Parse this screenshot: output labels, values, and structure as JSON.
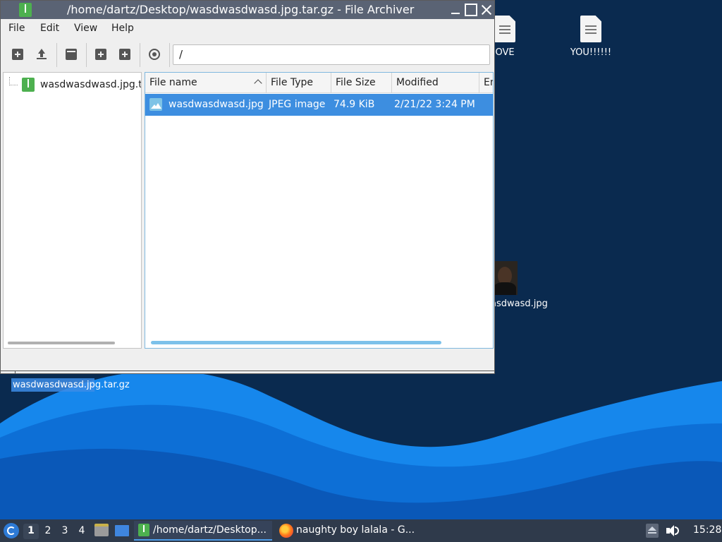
{
  "window": {
    "title": "/home/dartz/Desktop/wasdwasdwasd.jpg.tar.gz - File Archiver",
    "menus": [
      "File",
      "Edit",
      "View",
      "Help"
    ],
    "location": "/"
  },
  "tree": {
    "item": "wasdwasdwasd.jpg.tar.gz"
  },
  "list": {
    "columns": [
      "File name",
      "File Type",
      "File Size",
      "Modified",
      "En"
    ],
    "sort_column": "File name",
    "rows": [
      {
        "name": "wasdwasdwasd.jpg",
        "type": "JPEG image",
        "size": "74.9 KiB",
        "modified": "2/21/22 3:24 PM"
      }
    ]
  },
  "desktop": {
    "icons": [
      {
        "label": "OVE"
      },
      {
        "label": "YOU!!!!!!"
      },
      {
        "label": "asdwasd.jpg"
      },
      {
        "label": "wasdwasdwasd.jpg.tar.gz"
      }
    ]
  },
  "taskbar": {
    "workspaces": [
      "1",
      "2",
      "3",
      "4"
    ],
    "active_workspace": "1",
    "tasks": [
      {
        "label": "/home/dartz/Desktop..."
      },
      {
        "label": "naughty boy lalala - G..."
      }
    ],
    "clock": "15:28"
  },
  "colors": {
    "selection": "#3d8ee0",
    "titlebar": "#5a6374",
    "taskbar": "#2f3a4b",
    "desktop_dark": "#0a2a4f",
    "wave_light": "#1a8ff0"
  }
}
